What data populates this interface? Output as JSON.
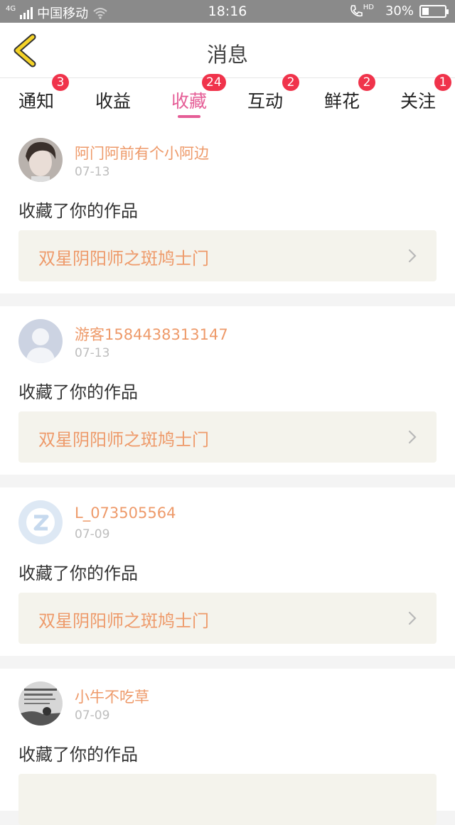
{
  "status_bar": {
    "network": "4G",
    "carrier": "中国移动",
    "time": "18:16",
    "hd": "HD",
    "battery_text": "30%",
    "battery_level": 0.3
  },
  "nav": {
    "title": "消息"
  },
  "tabs": [
    {
      "label": "通知",
      "badge": "3"
    },
    {
      "label": "收益",
      "badge": ""
    },
    {
      "label": "收藏",
      "badge": "24",
      "active": true
    },
    {
      "label": "互动",
      "badge": "2"
    },
    {
      "label": "鲜花",
      "badge": "2"
    },
    {
      "label": "关注",
      "badge": "1"
    }
  ],
  "feed": [
    {
      "user": "阿门阿前有个小阿边",
      "date": "07-13",
      "action": "收藏了你的作品",
      "work": "双星阴阳师之斑鸠士门",
      "avatar": "photo-avatar"
    },
    {
      "user": "游客1584438313147",
      "date": "07-13",
      "action": "收藏了你的作品",
      "work": "双星阴阳师之斑鸠士门",
      "avatar": "default-avatar"
    },
    {
      "user": "L_073505564",
      "date": "07-09",
      "action": "收藏了你的作品",
      "work": "双星阴阳师之斑鸠士门",
      "avatar": "qq-avatar"
    },
    {
      "user": "小牛不吃草",
      "date": "07-09",
      "action": "收藏了你的作品",
      "work": "",
      "avatar": "photo-avatar-bw"
    }
  ],
  "colors": {
    "accent": "#e55d96",
    "badge": "#f0334b",
    "username": "#ee9a6a",
    "back_arrow": "#f5d327"
  }
}
